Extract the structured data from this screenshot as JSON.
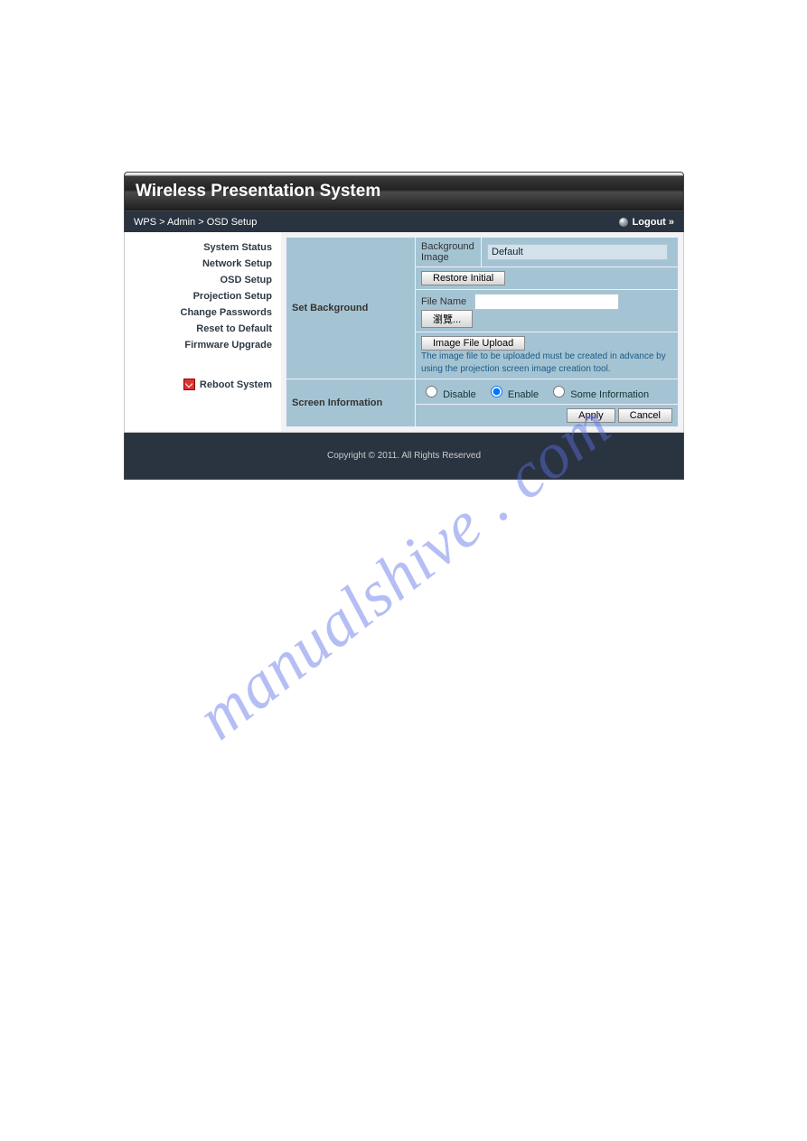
{
  "header": {
    "title": "Wireless Presentation System"
  },
  "breadcrumb": {
    "path": "WPS > Admin > OSD Setup",
    "logout": "Logout »"
  },
  "sidebar": {
    "items": [
      "System Status",
      "Network Setup",
      "OSD Setup",
      "Projection Setup",
      "Change Passwords",
      "Reset to Default",
      "Firmware Upgrade"
    ],
    "reboot": "Reboot System"
  },
  "osd": {
    "set_bg": {
      "label": "Set Background",
      "bg_image_label": "Background Image",
      "bg_image_value": "Default",
      "restore_btn": "Restore Initial",
      "file_name_label": "File Name",
      "file_name_value": "",
      "browse_btn": "瀏覽...",
      "upload_btn": "Image File Upload",
      "hint": "The image file to be uploaded must be created in advance by using the projection screen image creation tool."
    },
    "screen_info": {
      "label": "Screen Information",
      "options": [
        "Disable",
        "Enable",
        "Some Information"
      ],
      "selected": "Enable"
    },
    "actions": {
      "apply": "Apply",
      "cancel": "Cancel"
    }
  },
  "footer": {
    "text": "Copyright © 2011. All Rights Reserved"
  },
  "watermark": "manualshive . com"
}
